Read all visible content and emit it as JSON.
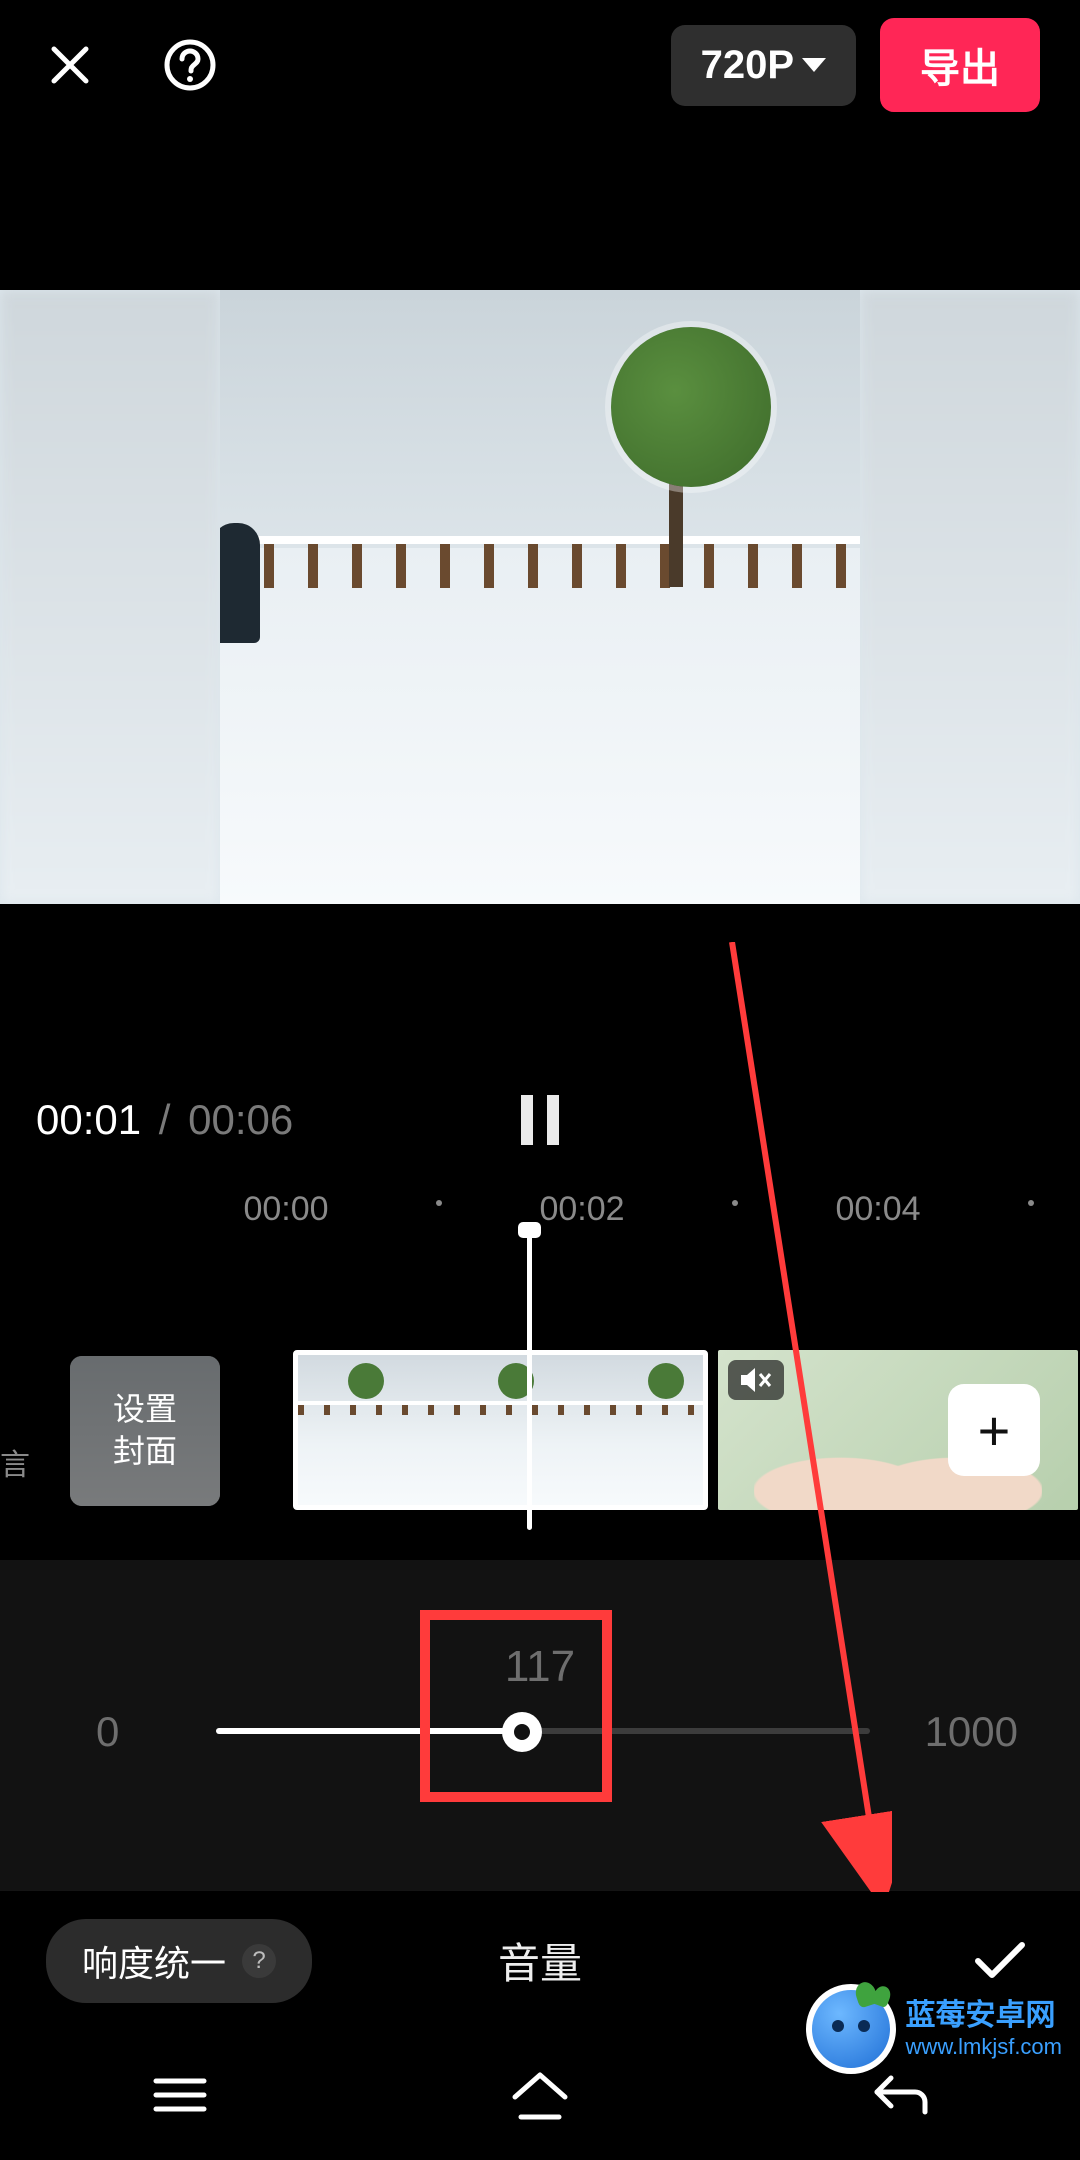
{
  "header": {
    "resolution_label": "720P",
    "export_label": "导出"
  },
  "playback": {
    "current": "00:01",
    "separator": "/",
    "duration": "00:06"
  },
  "ruler": {
    "t0": "00:00",
    "t1": "00:02",
    "t2": "00:04"
  },
  "track": {
    "cover_label": "设置\n封面",
    "add_label": "+",
    "audio_stub": "言"
  },
  "volume": {
    "value": "117",
    "min": "0",
    "max": "1000"
  },
  "toolbar": {
    "loudness_label": "响度统一",
    "help_char": "?",
    "panel_title": "音量"
  },
  "watermark": {
    "line1": "蓝莓安卓网",
    "line2": "www.lmkjsf.com"
  }
}
